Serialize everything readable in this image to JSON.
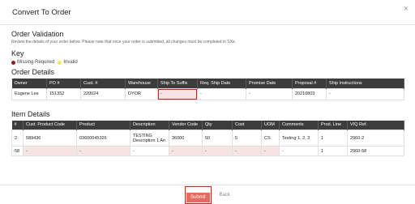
{
  "modal": {
    "title": "Convert To Order",
    "close_glyph": "×"
  },
  "validation": {
    "heading": "Order Validation",
    "description": "Review the details of your order below. Please note that once your order is submitted, all changes must be completed in SXe."
  },
  "key": {
    "heading": "Key",
    "missing_label": "Missing Required",
    "invalid_label": "Invalid"
  },
  "order_details": {
    "heading": "Order Details",
    "columns": [
      "Owner",
      "PO #",
      "Cust. #",
      "Warehouse",
      "Ship To Suffix",
      "Req. Ship Date",
      "Promise Date",
      "Proposal #",
      "Ship Instructions"
    ],
    "row": [
      "Eugene Lee",
      "151352",
      "220024",
      "DYOR",
      "-",
      "-",
      "-",
      "20210803",
      "-"
    ]
  },
  "item_details": {
    "heading": "Item Details",
    "columns": [
      "#",
      "Cust. Product Code",
      "Product",
      "Description",
      "Vendor Code",
      "Qty",
      "Cost",
      "UOM",
      "Comments",
      "Prod. Line",
      "VIQ Ref."
    ],
    "rows": [
      [
        "2",
        "589436",
        "03600045326",
        "TESTING Description 1 An",
        "36000",
        "50",
        "5",
        "CS",
        "Testing 1, 2, 3",
        "1",
        "2960-2"
      ],
      [
        "58",
        "-",
        "-",
        "-",
        "-",
        "-",
        "-",
        "-",
        "-",
        "1",
        "2960-58"
      ]
    ]
  },
  "footer": {
    "submit_label": "Submit",
    "back_label": "Back"
  },
  "colors": {
    "missing": "#8b2222",
    "invalid": "#f2ea5a",
    "header_bg": "#3c3c3c",
    "submit_bg": "#e56b5e",
    "highlight": "#d81b1b"
  }
}
